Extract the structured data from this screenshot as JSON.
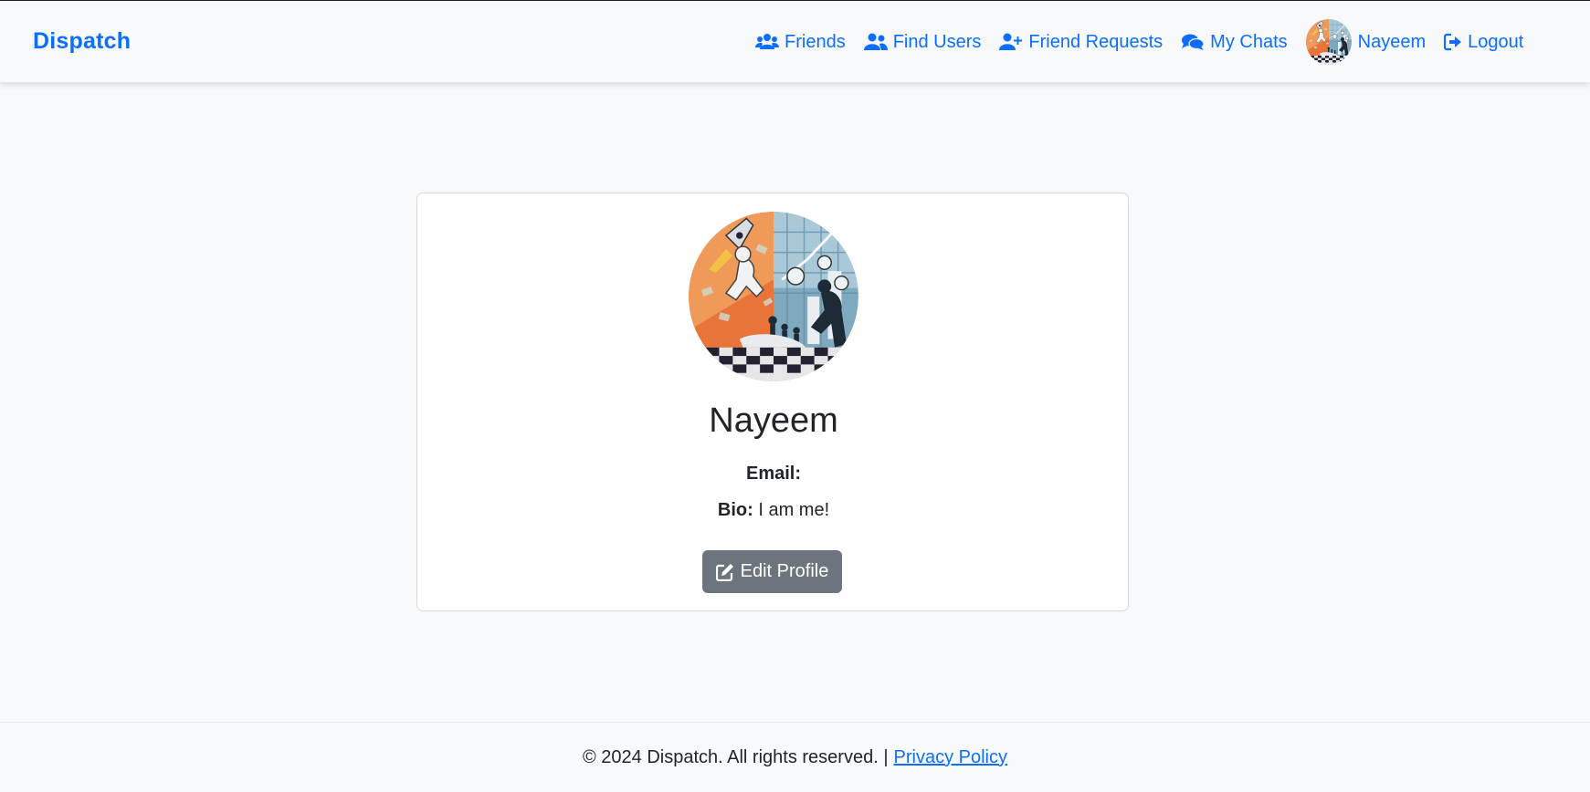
{
  "navbar": {
    "brand": "Dispatch",
    "items": [
      {
        "label": "Friends",
        "icon": "users-icon"
      },
      {
        "label": "Find Users",
        "icon": "user-group-icon"
      },
      {
        "label": "Friend Requests",
        "icon": "user-plus-icon"
      },
      {
        "label": "My Chats",
        "icon": "comments-icon"
      }
    ],
    "user": {
      "label": "Nayeem",
      "avatar": "profile-avatar"
    },
    "logout": {
      "label": "Logout",
      "icon": "logout-icon"
    }
  },
  "profile": {
    "name": "Nayeem",
    "email_label": "Email:",
    "email_value": "",
    "bio_label": "Bio:",
    "bio_value": "I am me!",
    "edit_button": "Edit Profile"
  },
  "footer": {
    "copyright": "© 2024 Dispatch. All rights reserved. |",
    "privacy_link": "Privacy Policy"
  },
  "colors": {
    "primary": "#0d6efd",
    "secondary": "#6c757d",
    "background": "#f8f9fa"
  }
}
